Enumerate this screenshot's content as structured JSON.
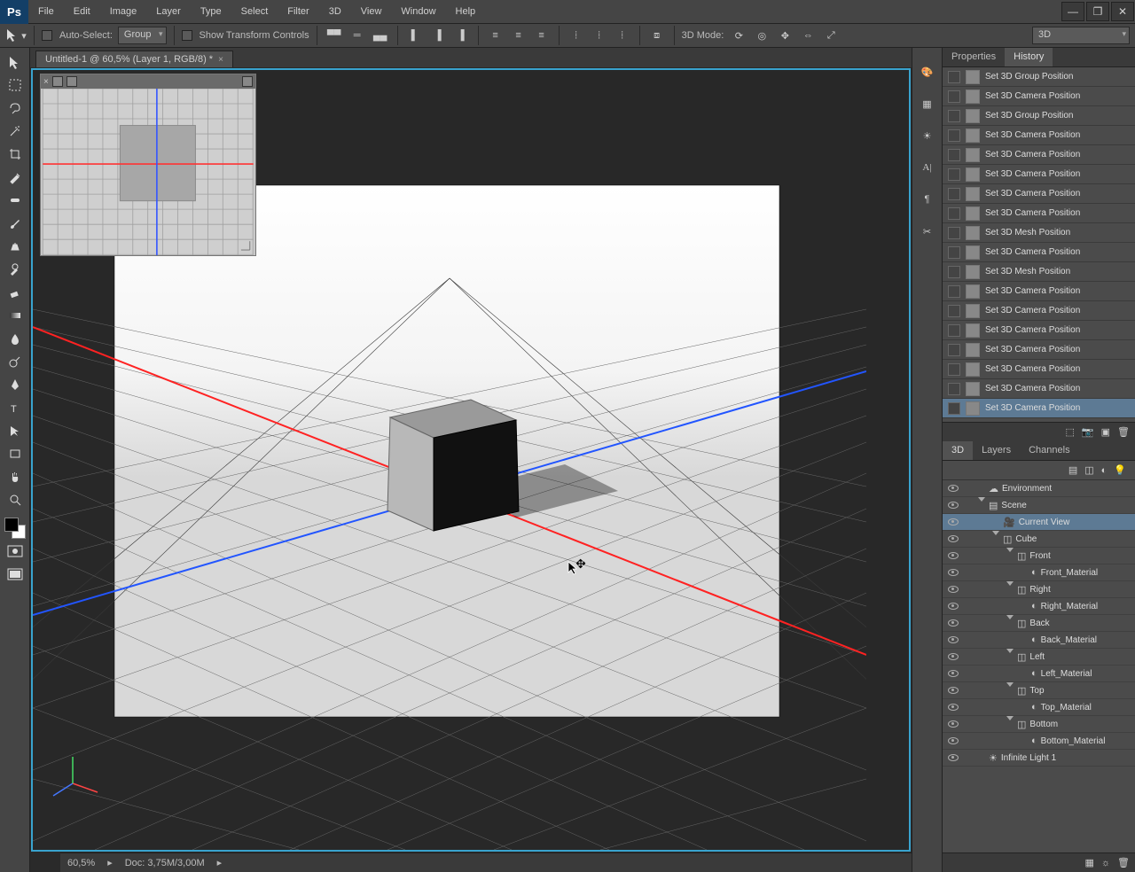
{
  "menu": [
    "File",
    "Edit",
    "Image",
    "Layer",
    "Type",
    "Select",
    "Filter",
    "3D",
    "View",
    "Window",
    "Help"
  ],
  "optbar": {
    "auto_select": "Auto-Select:",
    "group": "Group",
    "show_tc": "Show Transform Controls",
    "mode3d": "3D Mode:",
    "workspace": "3D"
  },
  "doc_tab": "Untitled-1 @ 60,5% (Layer 1, RGB/8) *",
  "status": {
    "zoom": "60,5%",
    "doc": "Doc: 3,75M/3,00M"
  },
  "panels": {
    "prop_tab": "Properties",
    "history_tab": "History",
    "tab_3d": "3D",
    "tab_layers": "Layers",
    "tab_channels": "Channels"
  },
  "history": [
    "Set 3D Group Position",
    "Set 3D Camera Position",
    "Set 3D Group Position",
    "Set 3D Camera Position",
    "Set 3D Camera Position",
    "Set 3D Camera Position",
    "Set 3D Camera Position",
    "Set 3D Camera Position",
    "Set 3D Mesh Position",
    "Set 3D Camera Position",
    "Set 3D Mesh Position",
    "Set 3D Camera Position",
    "Set 3D Camera Position",
    "Set 3D Camera Position",
    "Set 3D Camera Position",
    "Set 3D Camera Position",
    "Set 3D Camera Position",
    "Set 3D Camera Position"
  ],
  "history_sel": 17,
  "tree": [
    {
      "d": 0,
      "i": "env",
      "l": "Environment"
    },
    {
      "d": 0,
      "i": "scn",
      "l": "Scene",
      "tw": 1
    },
    {
      "d": 1,
      "i": "cam",
      "l": "Current View",
      "sel": 1
    },
    {
      "d": 1,
      "i": "msh",
      "l": "Cube",
      "tw": 1
    },
    {
      "d": 2,
      "i": "msh",
      "l": "Front",
      "tw": 1
    },
    {
      "d": 3,
      "i": "mat",
      "l": "Front_Material"
    },
    {
      "d": 2,
      "i": "msh",
      "l": "Right",
      "tw": 1
    },
    {
      "d": 3,
      "i": "mat",
      "l": "Right_Material"
    },
    {
      "d": 2,
      "i": "msh",
      "l": "Back",
      "tw": 1
    },
    {
      "d": 3,
      "i": "mat",
      "l": "Back_Material"
    },
    {
      "d": 2,
      "i": "msh",
      "l": "Left",
      "tw": 1
    },
    {
      "d": 3,
      "i": "mat",
      "l": "Left_Material"
    },
    {
      "d": 2,
      "i": "msh",
      "l": "Top",
      "tw": 1
    },
    {
      "d": 3,
      "i": "mat",
      "l": "Top_Material"
    },
    {
      "d": 2,
      "i": "msh",
      "l": "Bottom",
      "tw": 1
    },
    {
      "d": 3,
      "i": "mat",
      "l": "Bottom_Material"
    },
    {
      "d": 0,
      "i": "lit",
      "l": "Infinite Light 1"
    }
  ]
}
